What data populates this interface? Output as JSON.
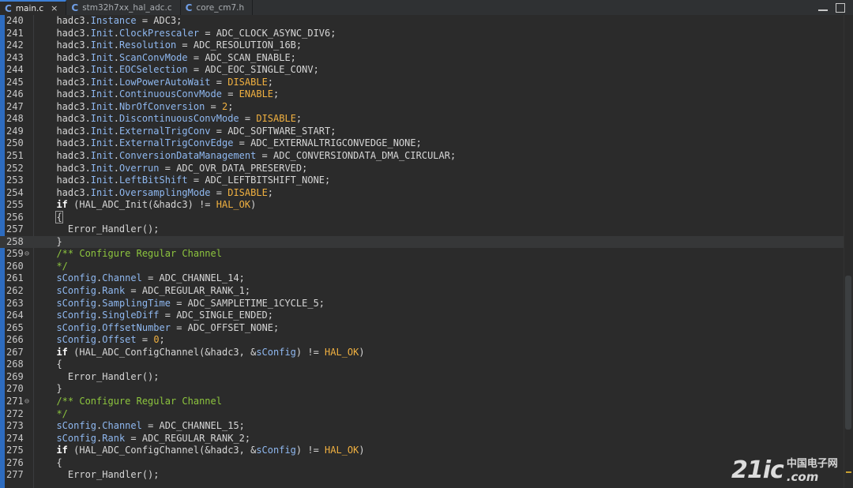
{
  "tabs": [
    {
      "label": "main.c",
      "icon": "c-file-icon",
      "active": true,
      "close": "×"
    },
    {
      "label": "stm32h7xx_hal_adc.c",
      "icon": "c-file-icon",
      "active": false
    },
    {
      "label": "core_cm7.h",
      "icon": "c-file-icon",
      "active": false
    }
  ],
  "window_controls": {
    "minimize": "minimize-icon",
    "maximize": "maximize-icon"
  },
  "lines": [
    {
      "n": "240",
      "code": [
        [
          "",
          "  hadc3."
        ],
        [
          "field",
          "Instance"
        ],
        [
          "",
          " = ADC3;"
        ]
      ]
    },
    {
      "n": "241",
      "code": [
        [
          "",
          "  hadc3."
        ],
        [
          "field",
          "Init"
        ],
        [
          "",
          "."
        ],
        [
          "field",
          "ClockPrescaler"
        ],
        [
          "",
          " = ADC_CLOCK_ASYNC_DIV6;"
        ]
      ]
    },
    {
      "n": "242",
      "code": [
        [
          "",
          "  hadc3."
        ],
        [
          "field",
          "Init"
        ],
        [
          "",
          "."
        ],
        [
          "field",
          "Resolution"
        ],
        [
          "",
          " = ADC_RESOLUTION_16B;"
        ]
      ]
    },
    {
      "n": "243",
      "code": [
        [
          "",
          "  hadc3."
        ],
        [
          "field",
          "Init"
        ],
        [
          "",
          "."
        ],
        [
          "field",
          "ScanConvMode"
        ],
        [
          "",
          " = ADC_SCAN_ENABLE;"
        ]
      ]
    },
    {
      "n": "244",
      "code": [
        [
          "",
          "  hadc3."
        ],
        [
          "field",
          "Init"
        ],
        [
          "",
          "."
        ],
        [
          "field",
          "EOCSelection"
        ],
        [
          "",
          " = ADC_EOC_SINGLE_CONV;"
        ]
      ]
    },
    {
      "n": "245",
      "code": [
        [
          "",
          "  hadc3."
        ],
        [
          "field",
          "Init"
        ],
        [
          "",
          "."
        ],
        [
          "field",
          "LowPowerAutoWait"
        ],
        [
          "",
          " = "
        ],
        [
          "const",
          "DISABLE"
        ],
        [
          "",
          ";"
        ]
      ]
    },
    {
      "n": "246",
      "code": [
        [
          "",
          "  hadc3."
        ],
        [
          "field",
          "Init"
        ],
        [
          "",
          "."
        ],
        [
          "field",
          "ContinuousConvMode"
        ],
        [
          "",
          " = "
        ],
        [
          "const",
          "ENABLE"
        ],
        [
          "",
          ";"
        ]
      ]
    },
    {
      "n": "247",
      "code": [
        [
          "",
          "  hadc3."
        ],
        [
          "field",
          "Init"
        ],
        [
          "",
          "."
        ],
        [
          "field",
          "NbrOfConversion"
        ],
        [
          "",
          " = "
        ],
        [
          "const",
          "2"
        ],
        [
          "",
          ";"
        ]
      ]
    },
    {
      "n": "248",
      "code": [
        [
          "",
          "  hadc3."
        ],
        [
          "field",
          "Init"
        ],
        [
          "",
          "."
        ],
        [
          "field",
          "DiscontinuousConvMode"
        ],
        [
          "",
          " = "
        ],
        [
          "const",
          "DISABLE"
        ],
        [
          "",
          ";"
        ]
      ]
    },
    {
      "n": "249",
      "code": [
        [
          "",
          "  hadc3."
        ],
        [
          "field",
          "Init"
        ],
        [
          "",
          "."
        ],
        [
          "field",
          "ExternalTrigConv"
        ],
        [
          "",
          " = ADC_SOFTWARE_START;"
        ]
      ]
    },
    {
      "n": "250",
      "code": [
        [
          "",
          "  hadc3."
        ],
        [
          "field",
          "Init"
        ],
        [
          "",
          "."
        ],
        [
          "field",
          "ExternalTrigConvEdge"
        ],
        [
          "",
          " = ADC_EXTERNALTRIGCONVEDGE_NONE;"
        ]
      ]
    },
    {
      "n": "251",
      "code": [
        [
          "",
          "  hadc3."
        ],
        [
          "field",
          "Init"
        ],
        [
          "",
          "."
        ],
        [
          "field",
          "ConversionDataManagement"
        ],
        [
          "",
          " = ADC_CONVERSIONDATA_DMA_CIRCULAR;"
        ]
      ]
    },
    {
      "n": "252",
      "code": [
        [
          "",
          "  hadc3."
        ],
        [
          "field",
          "Init"
        ],
        [
          "",
          "."
        ],
        [
          "field",
          "Overrun"
        ],
        [
          "",
          " = ADC_OVR_DATA_PRESERVED;"
        ]
      ]
    },
    {
      "n": "253",
      "code": [
        [
          "",
          "  hadc3."
        ],
        [
          "field",
          "Init"
        ],
        [
          "",
          "."
        ],
        [
          "field",
          "LeftBitShift"
        ],
        [
          "",
          " = ADC_LEFTBITSHIFT_NONE;"
        ]
      ]
    },
    {
      "n": "254",
      "code": [
        [
          "",
          "  hadc3."
        ],
        [
          "field",
          "Init"
        ],
        [
          "",
          "."
        ],
        [
          "field",
          "OversamplingMode"
        ],
        [
          "",
          " = "
        ],
        [
          "const",
          "DISABLE"
        ],
        [
          "",
          ";"
        ]
      ]
    },
    {
      "n": "255",
      "code": [
        [
          "kw",
          "  if"
        ],
        [
          "",
          " (HAL_ADC_Init(&hadc3) != "
        ],
        [
          "const",
          "HAL_OK"
        ],
        [
          "",
          ")"
        ]
      ]
    },
    {
      "n": "256",
      "code": [
        [
          "hl",
          "  {"
        ]
      ]
    },
    {
      "n": "257",
      "code": [
        [
          "",
          "    Error_Handler();"
        ]
      ]
    },
    {
      "n": "258",
      "code": [
        [
          "",
          "  }"
        ]
      ],
      "current": true
    },
    {
      "n": "259",
      "fold": "⊖",
      "code": [
        [
          "cmt",
          "  /** Configure Regular Channel"
        ]
      ]
    },
    {
      "n": "260",
      "code": [
        [
          "cmt",
          "  */"
        ]
      ]
    },
    {
      "n": "261",
      "code": [
        [
          "field",
          "  sConfig"
        ],
        [
          "",
          "."
        ],
        [
          "field",
          "Channel"
        ],
        [
          "",
          " = ADC_CHANNEL_14;"
        ]
      ]
    },
    {
      "n": "262",
      "code": [
        [
          "field",
          "  sConfig"
        ],
        [
          "",
          "."
        ],
        [
          "field",
          "Rank"
        ],
        [
          "",
          " = ADC_REGULAR_RANK_1;"
        ]
      ]
    },
    {
      "n": "263",
      "code": [
        [
          "field",
          "  sConfig"
        ],
        [
          "",
          "."
        ],
        [
          "field",
          "SamplingTime"
        ],
        [
          "",
          " = ADC_SAMPLETIME_1CYCLE_5;"
        ]
      ]
    },
    {
      "n": "264",
      "code": [
        [
          "field",
          "  sConfig"
        ],
        [
          "",
          "."
        ],
        [
          "field",
          "SingleDiff"
        ],
        [
          "",
          " = ADC_SINGLE_ENDED;"
        ]
      ]
    },
    {
      "n": "265",
      "code": [
        [
          "field",
          "  sConfig"
        ],
        [
          "",
          "."
        ],
        [
          "field",
          "OffsetNumber"
        ],
        [
          "",
          " = ADC_OFFSET_NONE;"
        ]
      ]
    },
    {
      "n": "266",
      "code": [
        [
          "field",
          "  sConfig"
        ],
        [
          "",
          "."
        ],
        [
          "field",
          "Offset"
        ],
        [
          "",
          " = "
        ],
        [
          "const",
          "0"
        ],
        [
          "",
          ";"
        ]
      ]
    },
    {
      "n": "267",
      "code": [
        [
          "kw",
          "  if"
        ],
        [
          "",
          " (HAL_ADC_ConfigChannel(&hadc3, &"
        ],
        [
          "field",
          "sConfig"
        ],
        [
          "",
          ") != "
        ],
        [
          "const",
          "HAL_OK"
        ],
        [
          "",
          ")"
        ]
      ]
    },
    {
      "n": "268",
      "code": [
        [
          "",
          "  {"
        ]
      ]
    },
    {
      "n": "269",
      "code": [
        [
          "",
          "    Error_Handler();"
        ]
      ]
    },
    {
      "n": "270",
      "code": [
        [
          "",
          "  }"
        ]
      ]
    },
    {
      "n": "271",
      "fold": "⊖",
      "code": [
        [
          "cmt",
          "  /** Configure Regular Channel"
        ]
      ]
    },
    {
      "n": "272",
      "code": [
        [
          "cmt",
          "  */"
        ]
      ]
    },
    {
      "n": "273",
      "code": [
        [
          "field",
          "  sConfig"
        ],
        [
          "",
          "."
        ],
        [
          "field",
          "Channel"
        ],
        [
          "",
          " = ADC_CHANNEL_15;"
        ]
      ]
    },
    {
      "n": "274",
      "code": [
        [
          "field",
          "  sConfig"
        ],
        [
          "",
          "."
        ],
        [
          "field",
          "Rank"
        ],
        [
          "",
          " = ADC_REGULAR_RANK_2;"
        ]
      ]
    },
    {
      "n": "275",
      "code": [
        [
          "kw",
          "  if"
        ],
        [
          "",
          " (HAL_ADC_ConfigChannel(&hadc3, &"
        ],
        [
          "field",
          "sConfig"
        ],
        [
          "",
          ") != "
        ],
        [
          "const",
          "HAL_OK"
        ],
        [
          "",
          ")"
        ]
      ]
    },
    {
      "n": "276",
      "code": [
        [
          "",
          "  {"
        ]
      ]
    },
    {
      "n": "277",
      "code": [
        [
          "",
          "    Error_Handler();"
        ]
      ]
    }
  ],
  "watermark": {
    "logo": "21ic",
    "cn": "中国电子网",
    "com": ".com"
  },
  "colors": {
    "accent": "#3d7fd6",
    "keyword": "#ffffff",
    "constant": "#f0b040",
    "field": "#8fb8f0",
    "comment": "#8dc53e",
    "background": "#2b2b2b"
  }
}
